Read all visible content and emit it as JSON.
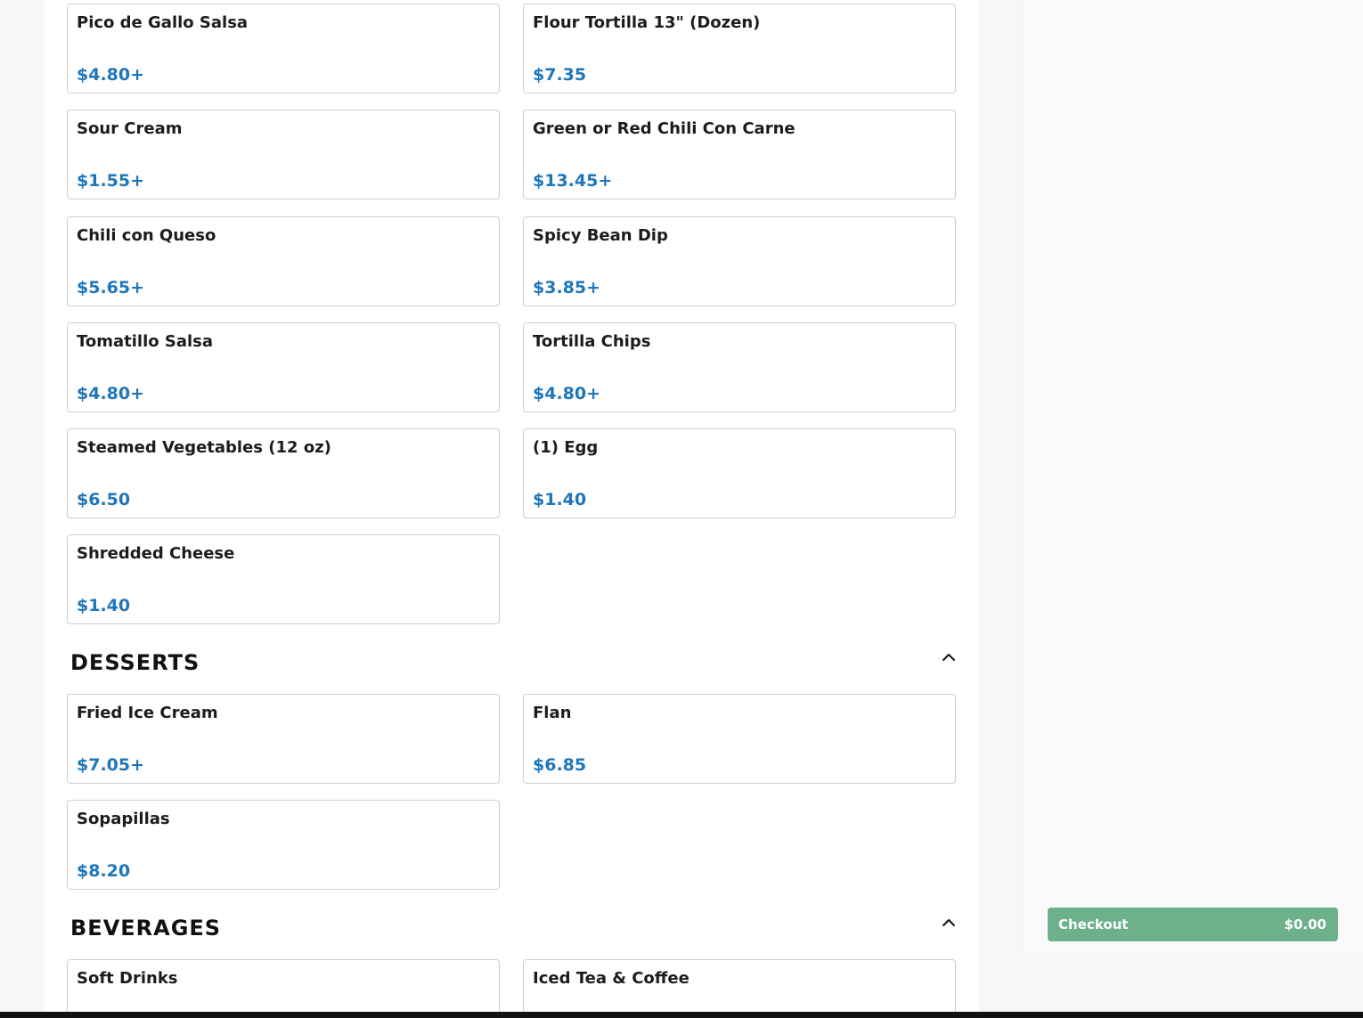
{
  "sections": {
    "sides": {
      "items": [
        {
          "name": "Pico de Gallo Salsa",
          "price": "$4.80+"
        },
        {
          "name": "Flour Tortilla 13\" (Dozen)",
          "price": "$7.35"
        },
        {
          "name": "Sour Cream",
          "price": "$1.55+"
        },
        {
          "name": "Green or Red Chili Con Carne",
          "price": "$13.45+"
        },
        {
          "name": "Chili con Queso",
          "price": "$5.65+"
        },
        {
          "name": "Spicy Bean Dip",
          "price": "$3.85+"
        },
        {
          "name": "Tomatillo Salsa",
          "price": "$4.80+"
        },
        {
          "name": "Tortilla Chips",
          "price": "$4.80+"
        },
        {
          "name": "Steamed Vegetables (12 oz)",
          "price": "$6.50"
        },
        {
          "name": "(1) Egg",
          "price": "$1.40"
        },
        {
          "name": "Shredded Cheese",
          "price": "$1.40"
        }
      ]
    },
    "desserts": {
      "title": "DESSERTS",
      "toggle_icon": "chevron-up-icon",
      "items": [
        {
          "name": "Fried Ice Cream",
          "price": "$7.05+"
        },
        {
          "name": "Flan",
          "price": "$6.85"
        },
        {
          "name": "Sopapillas",
          "price": "$8.20"
        }
      ]
    },
    "beverages": {
      "title": "BEVERAGES",
      "toggle_icon": "chevron-up-icon",
      "items": [
        {
          "name": "Soft Drinks",
          "price": ""
        },
        {
          "name": "Iced Tea & Coffee",
          "price": ""
        }
      ]
    }
  },
  "checkout": {
    "label": "Checkout",
    "total": "$0.00",
    "color": "#6cb08c"
  },
  "colors": {
    "price": "#1f76ba",
    "card_border": "#cfcfcf"
  }
}
